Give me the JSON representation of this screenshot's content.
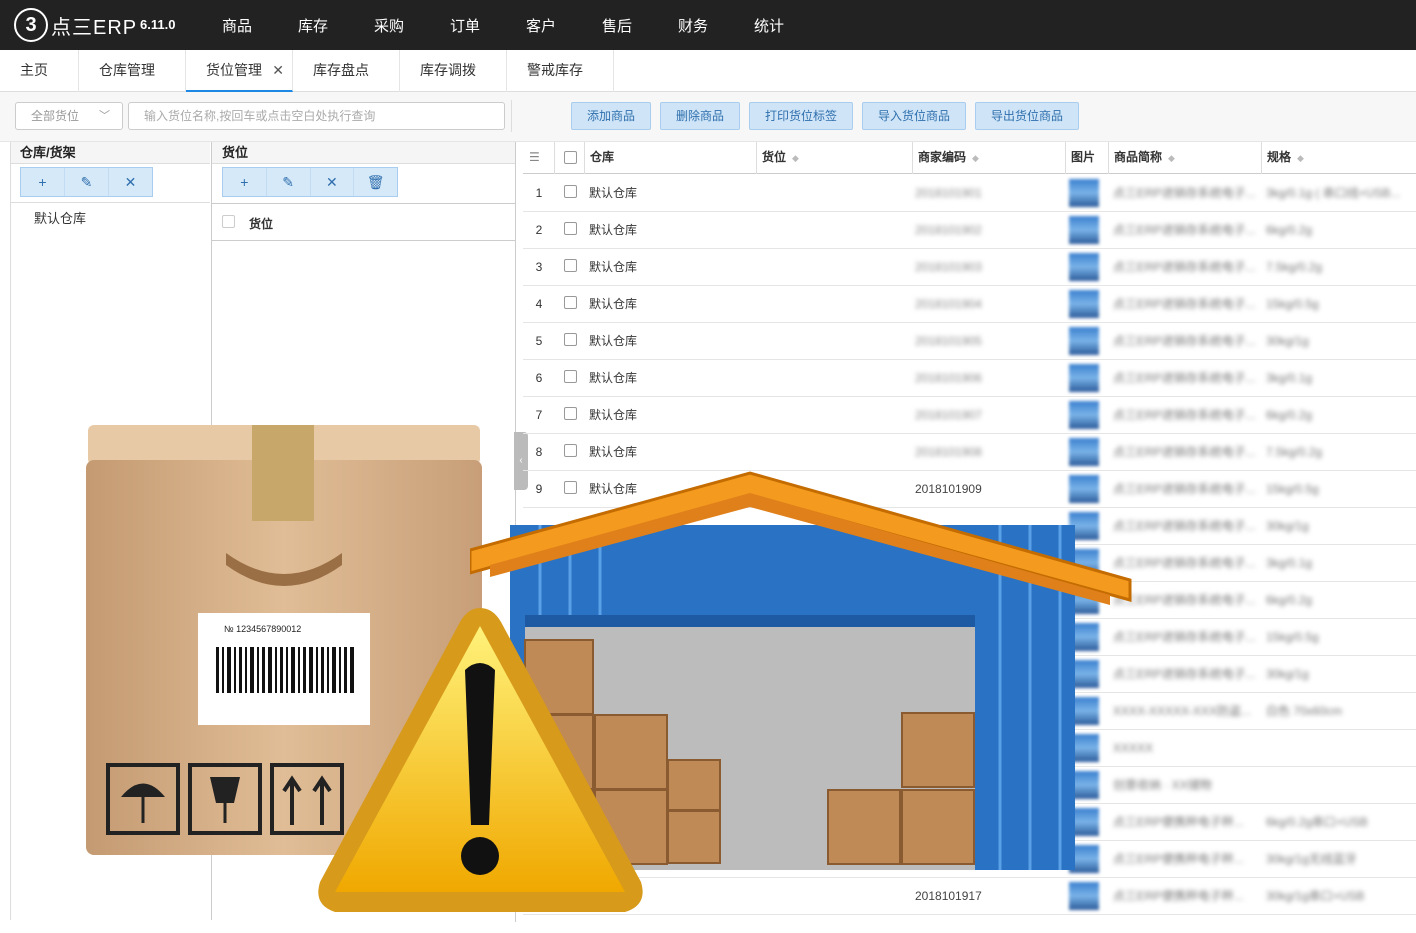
{
  "app": {
    "logo_glyph": "3",
    "logo_text": "点三ERP",
    "version": "6.11.0"
  },
  "nav": [
    "商品",
    "库存",
    "采购",
    "订单",
    "客户",
    "售后",
    "财务",
    "统计"
  ],
  "tabs": [
    {
      "label": "主页"
    },
    {
      "label": "仓库管理"
    },
    {
      "label": "货位管理",
      "active": true
    },
    {
      "label": "库存盘点"
    },
    {
      "label": "库存调拨"
    },
    {
      "label": "警戒库存"
    }
  ],
  "toolbar": {
    "location_select": "全部货位",
    "search_placeholder": "输入货位名称,按回车或点击空白处执行查询",
    "buttons": [
      "添加商品",
      "删除商品",
      "打印货位标签",
      "导入货位商品",
      "导出货位商品"
    ]
  },
  "left_panel": {
    "title": "仓库/货架",
    "tree_item": "默认仓库"
  },
  "mid_panel": {
    "title": "货位",
    "column": "货位"
  },
  "grid": {
    "columns": [
      "仓库",
      "货位",
      "商家编码",
      "图片",
      "商品简称",
      "规格"
    ],
    "rows": [
      {
        "num": "1",
        "warehouse": "默认仓库",
        "code": "2018101901",
        "name": "点三ERP进销存系统电子...",
        "spec": "3kg/0.1g ( 串口线+USB..."
      },
      {
        "num": "2",
        "warehouse": "默认仓库",
        "code": "2018101902",
        "name": "点三ERP进销存系统电子...",
        "spec": "6kg/0.2g"
      },
      {
        "num": "3",
        "warehouse": "默认仓库",
        "code": "2018101903",
        "name": "点三ERP进销存系统电子...",
        "spec": "7.5kg/0.2g"
      },
      {
        "num": "4",
        "warehouse": "默认仓库",
        "code": "2018101904",
        "name": "点三ERP进销存系统电子...",
        "spec": "15kg/0.5g"
      },
      {
        "num": "5",
        "warehouse": "默认仓库",
        "code": "2018101905",
        "name": "点三ERP进销存系统电子...",
        "spec": "30kg/1g"
      },
      {
        "num": "6",
        "warehouse": "默认仓库",
        "code": "2018101906",
        "name": "点三ERP进销存系统电子...",
        "spec": "3kg/0.1g"
      },
      {
        "num": "7",
        "warehouse": "默认仓库",
        "code": "2018101907",
        "name": "点三ERP进销存系统电子...",
        "spec": "6kg/0.2g"
      },
      {
        "num": "8",
        "warehouse": "默认仓库",
        "code": "2018101908",
        "name": "点三ERP进销存系统电子...",
        "spec": "7.5kg/0.2g"
      },
      {
        "num": "9",
        "warehouse": "默认仓库",
        "code": "2018101909",
        "name": "点三ERP进销存系统电子...",
        "spec": "15kg/0.5g"
      }
    ],
    "extra_rows": [
      {
        "name": "点三ERP进销存系统电子...",
        "spec": "30kg/1g"
      },
      {
        "name": "点三ERP进销存系统电子...",
        "spec": "3kg/0.1g"
      },
      {
        "name": "点三ERP进销存系统电子...",
        "spec": "6kg/0.2g"
      },
      {
        "name": "点三ERP进销存系统电子...",
        "spec": "15kg/0.5g"
      },
      {
        "name": "点三ERP进销存系统电子...",
        "spec": "30kg/1g"
      },
      {
        "name": "XXXX-XXXXX-XXX防盗...",
        "spec": "白色 70x60cm"
      },
      {
        "name": "XXXXX",
        "spec": ""
      },
      {
        "name": "创意收纳 · XX储物",
        "spec": ""
      },
      {
        "name": "点三ERP便携秤电子秤...",
        "spec": "6kg/0.2g串口+USB"
      },
      {
        "name": "点三ERP便携秤电子秤...",
        "spec": "30kg/1g无线蓝牙"
      }
    ],
    "last_row": {
      "code": "2018101917",
      "name": "点三ERP便携秤电子秤...",
      "spec": "30kg/1g串口+USB"
    }
  },
  "colors": {
    "topbar": "#222222",
    "accent": "#1e88e5",
    "button_bg": "#cfe5f7"
  }
}
